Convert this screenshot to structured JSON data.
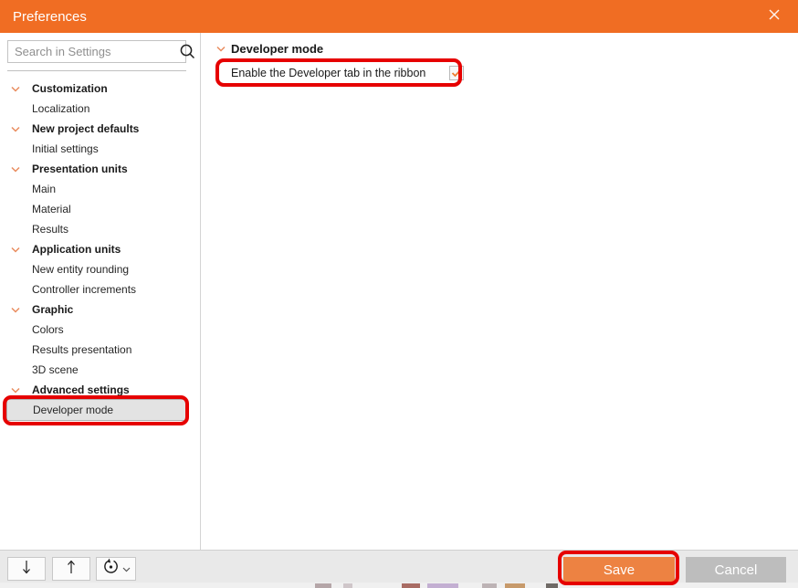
{
  "titlebar": {
    "title": "Preferences",
    "close_icon": "x"
  },
  "search": {
    "placeholder": "Search in Settings",
    "value": ""
  },
  "sidebar": {
    "tree": [
      {
        "label": "Customization",
        "type": "category"
      },
      {
        "label": "Localization",
        "type": "item"
      },
      {
        "label": "New project defaults",
        "type": "category"
      },
      {
        "label": "Initial settings",
        "type": "item"
      },
      {
        "label": "Presentation units",
        "type": "category"
      },
      {
        "label": "Main",
        "type": "item"
      },
      {
        "label": "Material",
        "type": "item"
      },
      {
        "label": "Results",
        "type": "item"
      },
      {
        "label": "Application units",
        "type": "category"
      },
      {
        "label": "New entity rounding",
        "type": "item"
      },
      {
        "label": "Controller increments",
        "type": "item"
      },
      {
        "label": "Graphic",
        "type": "category"
      },
      {
        "label": "Colors",
        "type": "item"
      },
      {
        "label": "Results presentation",
        "type": "item"
      },
      {
        "label": "3D scene",
        "type": "item"
      },
      {
        "label": "Advanced settings",
        "type": "category"
      },
      {
        "label": "Developer mode",
        "type": "item",
        "selected": true
      }
    ]
  },
  "main": {
    "section_title": "Developer mode",
    "checkbox_label": "Enable the Developer tab in the ribbon",
    "checkbox_checked": true
  },
  "footer": {
    "save_label": "Save",
    "cancel_label": "Cancel"
  },
  "colors": {
    "titlebar_orange": "#F06D23",
    "save_orange": "#ED8242",
    "cancel_gray": "#BDBDBD",
    "annotation_red": "#E60000",
    "chevron_orange": "#E98C5E",
    "check_orange": "#ED7D31",
    "selected_row_gray": "#E3E3E3"
  }
}
